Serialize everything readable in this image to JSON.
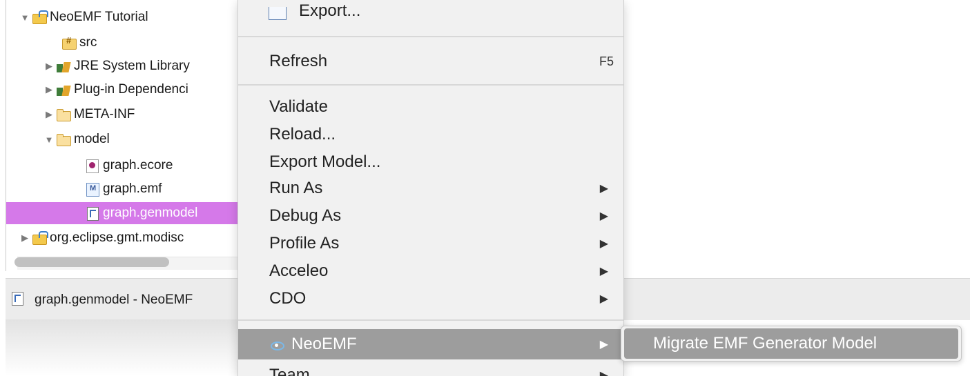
{
  "explorer": {
    "items": [
      {
        "label": "NeoEMF Tutorial",
        "twisty": "▼",
        "icon": "project-icon"
      },
      {
        "label": "src",
        "twisty": "",
        "icon": "source-folder-icon"
      },
      {
        "label": "JRE System Library",
        "twisty": "▶",
        "icon": "library-icon"
      },
      {
        "label": "Plug-in Dependenci",
        "twisty": "▶",
        "icon": "library-icon"
      },
      {
        "label": "META-INF",
        "twisty": "▶",
        "icon": "folder-icon"
      },
      {
        "label": "model",
        "twisty": "▼",
        "icon": "folder-icon"
      },
      {
        "label": "graph.ecore",
        "twisty": "",
        "icon": "ecore-file-icon"
      },
      {
        "label": "graph.emf",
        "twisty": "",
        "icon": "emf-file-icon"
      },
      {
        "label": "graph.genmodel",
        "twisty": "",
        "icon": "genmodel-file-icon",
        "selected": true
      },
      {
        "label": "org.eclipse.gmt.modisc",
        "twisty": "▶",
        "icon": "project-icon"
      }
    ]
  },
  "status": {
    "text": "graph.genmodel - NeoEMF"
  },
  "menu": {
    "export": "Export...",
    "refresh": "Refresh",
    "refresh_accel": "F5",
    "validate": "Validate",
    "reload": "Reload...",
    "export_model": "Export Model...",
    "run_as": "Run As",
    "debug_as": "Debug As",
    "profile_as": "Profile As",
    "acceleo": "Acceleo",
    "cdo": "CDO",
    "neoemf": "NeoEMF",
    "team": "Team",
    "arrow": "▶"
  },
  "submenu": {
    "migrate": "Migrate EMF Generator Model"
  },
  "colors": {
    "selection": "#d579e9",
    "menu_active": "#9d9d9d",
    "menu_bg": "#f1f1f1"
  }
}
